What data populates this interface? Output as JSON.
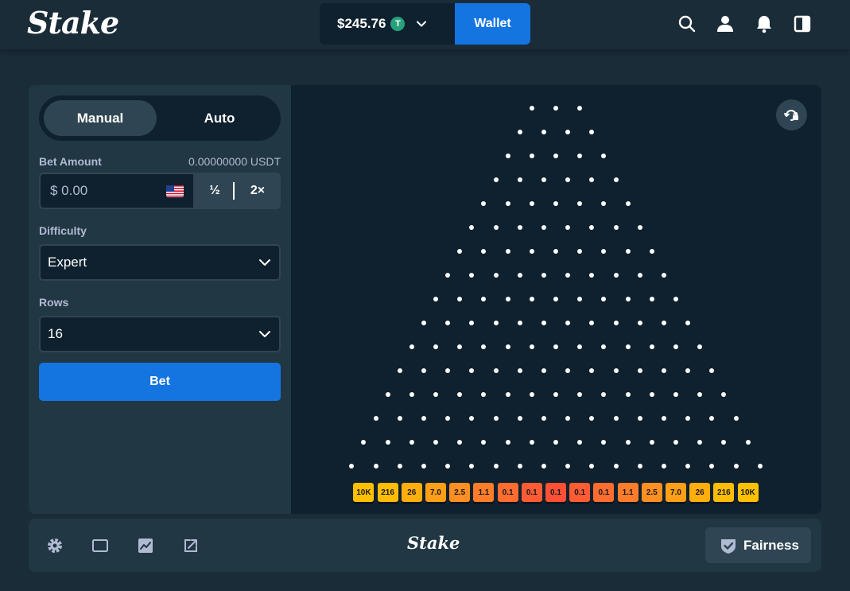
{
  "header": {
    "logo": "Stake",
    "balance": "$245.76",
    "currency_symbol": "T",
    "currency_icon": "tether-coin-icon",
    "wallet_label": "Wallet",
    "icons": [
      "search-icon",
      "user-icon",
      "bell-icon",
      "sidebar-toggle-icon"
    ]
  },
  "sidebar": {
    "tabs": [
      {
        "label": "Manual",
        "active": true
      },
      {
        "label": "Auto",
        "active": false
      }
    ],
    "bet_amount_label": "Bet Amount",
    "bet_amount_crypto": "0.00000000 USDT",
    "bet_amount_value": "$ 0.00",
    "half_label": "½",
    "double_label": "2×",
    "difficulty_label": "Difficulty",
    "difficulty_value": "Expert",
    "rows_label": "Rows",
    "rows_value": "16",
    "bet_label": "Bet"
  },
  "board": {
    "rows": 16,
    "multipliers": [
      "10K",
      "216",
      "26",
      "7.0",
      "2.5",
      "1.1",
      "0.1",
      "0.1",
      "0.1",
      "0.1",
      "0.1",
      "1.1",
      "2.5",
      "7.0",
      "26",
      "216",
      "10K"
    ],
    "bucket_colors": [
      "#ffc000",
      "#ffbc04",
      "#ffae0e",
      "#ff9f18",
      "#ff8f22",
      "#ff7d2a",
      "#ff6c30",
      "#ff5c34",
      "#ff5036",
      "#ff5c34",
      "#ff6c30",
      "#ff7d2a",
      "#ff8f22",
      "#ff9f18",
      "#ffae0e",
      "#ffbc04",
      "#ffc000"
    ],
    "tool_icon": "live-stats-icon"
  },
  "footer": {
    "icons": [
      "settings-icon",
      "theatre-mode-icon",
      "stats-icon",
      "popout-icon"
    ],
    "logo": "Stake",
    "fairness_label": "Fairness"
  },
  "colors": {
    "background": "#1a2c38",
    "panel": "#213743",
    "dark": "#0f212e",
    "control": "#2f4553",
    "accent_blue": "#1475e1",
    "label": "#b1bad3"
  }
}
